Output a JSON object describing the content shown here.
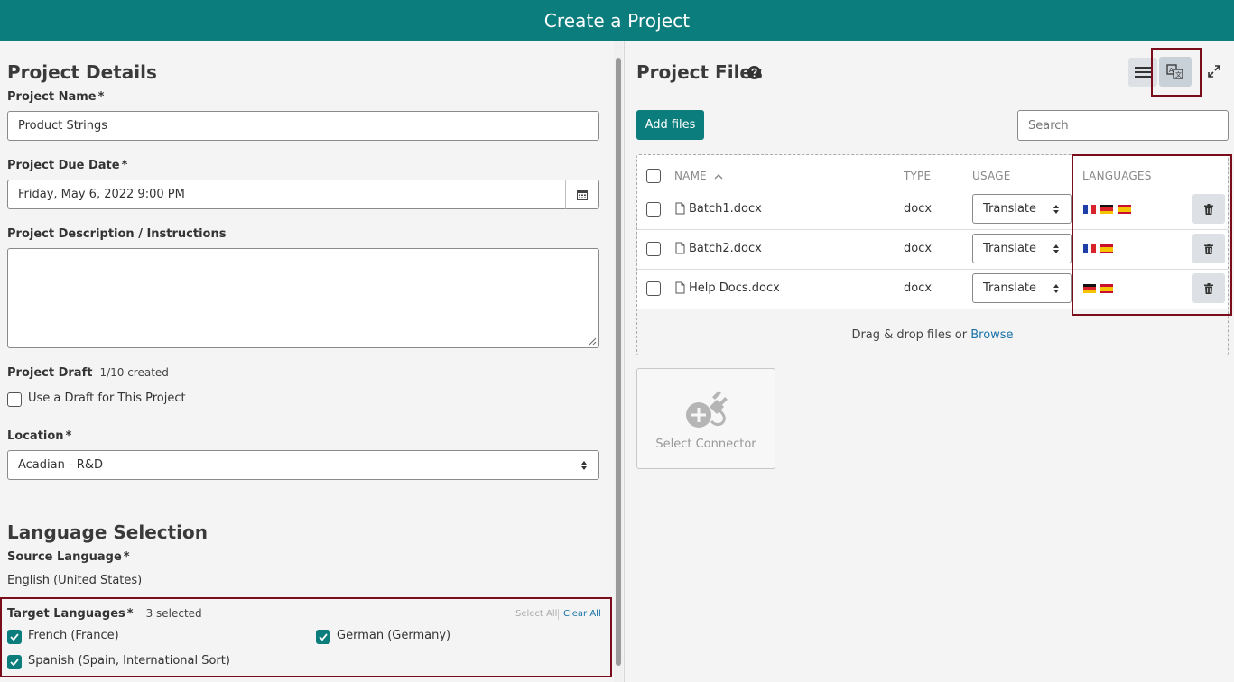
{
  "header": {
    "title": "Create a Project"
  },
  "details": {
    "section_title": "Project Details",
    "name_label": "Project Name",
    "name_value": "Product Strings",
    "due_label": "Project Due Date",
    "due_value": "Friday, May 6, 2022 9:00 PM",
    "desc_label": "Project Description / Instructions",
    "draft_label": "Project Draft",
    "draft_count": "1/10 created",
    "draft_checkbox": "Use a Draft for This Project",
    "location_label": "Location",
    "location_value": "Acadian - R&D",
    "required_mark": "*"
  },
  "language": {
    "section_title": "Language Selection",
    "source_label": "Source Language",
    "source_value": "English (United States)",
    "target_label": "Target Languages",
    "selected_count": "3 selected",
    "select_all": "Select All",
    "clear_all": "Clear All",
    "targets": [
      {
        "label": "French (France)",
        "checked": true
      },
      {
        "label": "German (Germany)",
        "checked": true
      },
      {
        "label": "Spanish (Spain, International Sort)",
        "checked": true
      }
    ]
  },
  "files": {
    "section_title": "Project Files",
    "add_files": "Add files",
    "search_placeholder": "Search",
    "columns": {
      "name": "NAME",
      "type": "TYPE",
      "usage": "USAGE",
      "languages": "LANGUAGES"
    },
    "rows": [
      {
        "name": "Batch1.docx",
        "type": "docx",
        "usage": "Translate",
        "languages": [
          "fr",
          "de",
          "es"
        ]
      },
      {
        "name": "Batch2.docx",
        "type": "docx",
        "usage": "Translate",
        "languages": [
          "fr",
          "es"
        ]
      },
      {
        "name": "Help Docs.docx",
        "type": "docx",
        "usage": "Translate",
        "languages": [
          "de",
          "es"
        ]
      }
    ],
    "drop_text": "Drag & drop files or",
    "browse": "Browse",
    "connector_label": "Select Connector"
  },
  "colors": {
    "primary": "#0b7d7d",
    "highlight": "#7b0c1c"
  }
}
